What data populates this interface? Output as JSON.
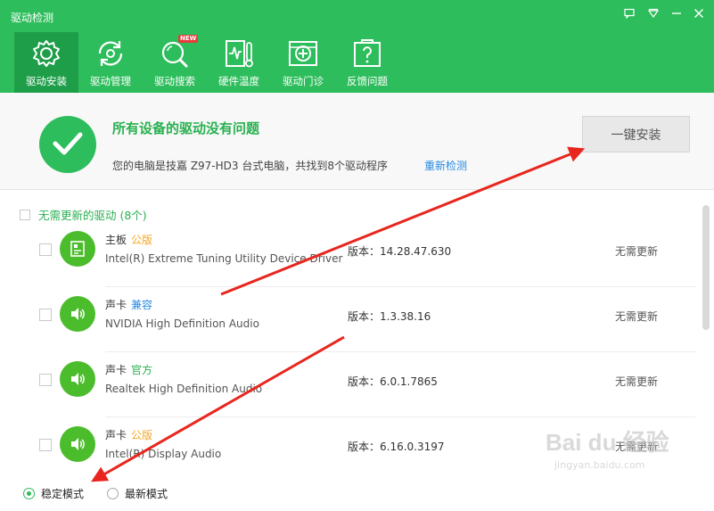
{
  "window": {
    "title": "驱动检测",
    "controls": [
      "feedback-icon",
      "menu-icon",
      "minimize-icon",
      "close-icon"
    ]
  },
  "toolbar": {
    "items": [
      {
        "label": "驱动安装",
        "icon": "gear-icon",
        "active": true
      },
      {
        "label": "驱动管理",
        "icon": "refresh-gear-icon"
      },
      {
        "label": "驱动搜索",
        "icon": "search-icon",
        "badge": "NEW"
      },
      {
        "label": "硬件温度",
        "icon": "temperature-icon"
      },
      {
        "label": "驱动门诊",
        "icon": "clinic-icon"
      },
      {
        "label": "反馈问题",
        "icon": "question-icon"
      }
    ]
  },
  "banner": {
    "headline": "所有设备的驱动没有问题",
    "subline": "您的电脑是技嘉 Z97-HD3 台式电脑，共找到8个驱动程序",
    "redetect": "重新检测",
    "install_button": "一键安装"
  },
  "group": {
    "label": "无需更新的驱动 (8个)"
  },
  "drivers": [
    {
      "category": "主板",
      "tag": "公版",
      "tag_color": "#f5a623",
      "name": "Intel(R) Extreme Tuning Utility Device Driver",
      "version": "版本：14.28.47.630",
      "status": "无需更新",
      "icon": "motherboard-icon"
    },
    {
      "category": "声卡",
      "tag": "兼容",
      "tag_color": "#2a8ae0",
      "name": "NVIDIA High Definition Audio",
      "version": "版本：1.3.38.16",
      "status": "无需更新",
      "icon": "speaker-icon"
    },
    {
      "category": "声卡",
      "tag": "官方",
      "tag_color": "#27b04f",
      "name": "Realtek High Definition Audio",
      "version": "版本：6.0.1.7865",
      "status": "无需更新",
      "icon": "speaker-icon"
    },
    {
      "category": "声卡",
      "tag": "公版",
      "tag_color": "#f5a623",
      "name": "Intel(R) Display Audio",
      "version": "版本：6.16.0.3197",
      "status": "无需更新",
      "icon": "speaker-icon"
    }
  ],
  "modes": {
    "stable": "稳定模式",
    "latest": "最新模式",
    "selected": "stable"
  },
  "watermark": {
    "brand": "Bai du 经验",
    "url": "jingyan.baidu.com"
  },
  "colors": {
    "brand_green": "#2ebd5c",
    "active_tab": "#1f9e4a",
    "link_blue": "#2a8ae0",
    "arrow_red": "#e8261e"
  }
}
